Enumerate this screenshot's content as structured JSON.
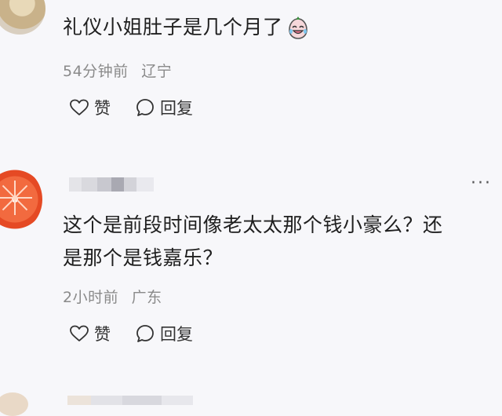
{
  "comments": [
    {
      "text": "礼仪小姐肚子是几个月了",
      "emoji": "crying-laughing-emoji",
      "time": "54分钟前",
      "location": "辽宁",
      "like_label": "赞",
      "reply_label": "回复"
    },
    {
      "more_label": "···",
      "text_line1": "这个是前段时间像老太太那个钱小豪么？还",
      "text_line2": "是那个是钱嘉乐？",
      "time": "2小时前",
      "location": "广东",
      "like_label": "赞",
      "reply_label": "回复"
    }
  ],
  "icons": {
    "like": "heart-outline-icon",
    "reply": "speech-bubble-icon",
    "more": "more-dots-icon"
  },
  "colors": {
    "background": "#f7f7fa",
    "text": "#1f1f1f",
    "meta": "#8a8a8a"
  }
}
